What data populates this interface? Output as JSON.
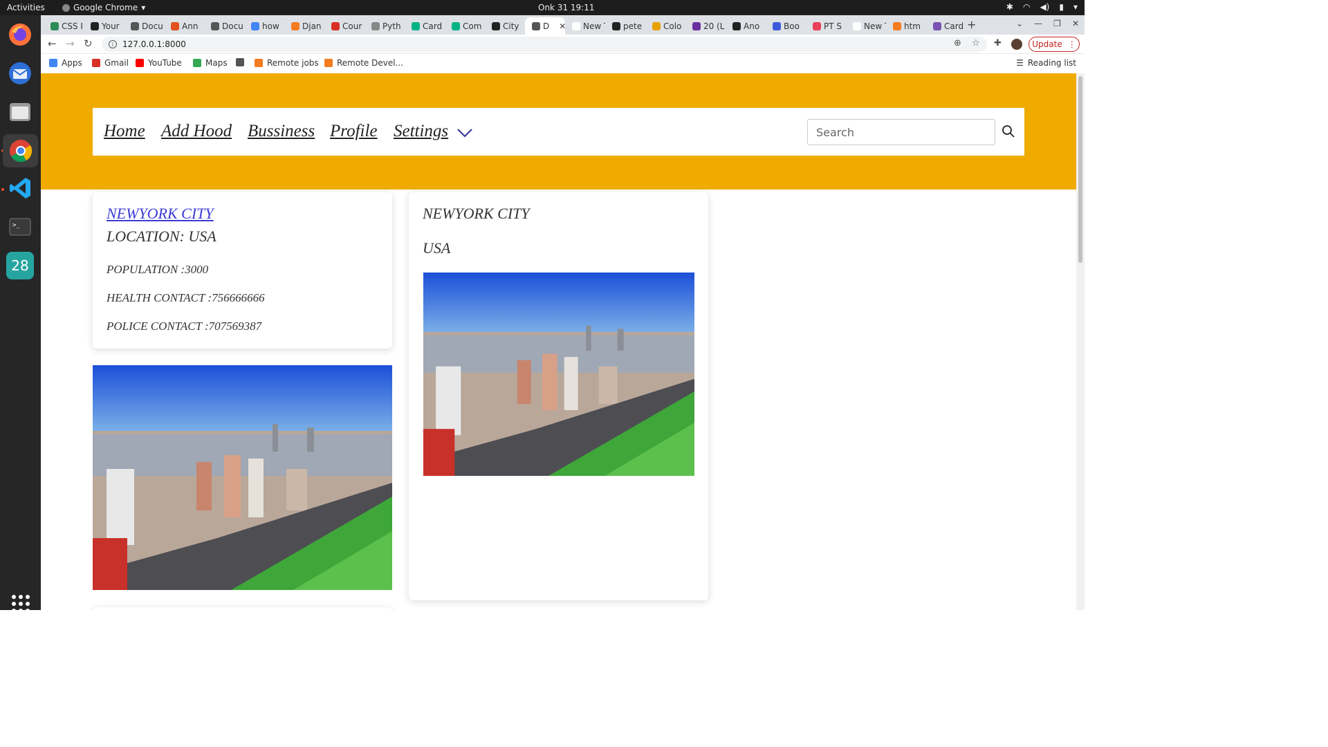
{
  "os": {
    "activities": "Activities",
    "app_name": "Google Chrome",
    "clock": "Onk 31  19:11",
    "calendar_day": "28"
  },
  "browser": {
    "tabs": [
      {
        "label": "CSS I",
        "color": "#2e8b57"
      },
      {
        "label": "Your",
        "color": "#222222"
      },
      {
        "label": "Docu",
        "color": "#555555"
      },
      {
        "label": "Ann",
        "color": "#e0521e"
      },
      {
        "label": "Docu",
        "color": "#555555"
      },
      {
        "label": "how",
        "color": "#4285f4"
      },
      {
        "label": "Djan",
        "color": "#f47b20"
      },
      {
        "label": "Cour",
        "color": "#d93025"
      },
      {
        "label": "Pyth",
        "color": "#888888"
      },
      {
        "label": "Card",
        "color": "#00b386"
      },
      {
        "label": "Com",
        "color": "#00b386"
      },
      {
        "label": "City",
        "color": "#222222"
      },
      {
        "label": "D",
        "color": "#555555",
        "active": true
      },
      {
        "label": "New Ta",
        "color": "#ffffff"
      },
      {
        "label": "pete",
        "color": "#222222"
      },
      {
        "label": "Colo",
        "color": "#e8a200"
      },
      {
        "label": "20 (L",
        "color": "#6b2fa0"
      },
      {
        "label": "Ano",
        "color": "#222222"
      },
      {
        "label": "Boo",
        "color": "#3b5bdb"
      },
      {
        "label": "PT S",
        "color": "#e94057"
      },
      {
        "label": "New Ta",
        "color": "#ffffff"
      },
      {
        "label": "htm",
        "color": "#f47b20"
      },
      {
        "label": "Card",
        "color": "#7952b3"
      }
    ],
    "url": "127.0.0.1:8000",
    "update_label": "Update",
    "bookmarks": [
      {
        "label": "Apps",
        "color": "#4285f4"
      },
      {
        "label": "Gmail",
        "color": "#d93025"
      },
      {
        "label": "YouTube",
        "color": "#ff0000"
      },
      {
        "label": "Maps",
        "color": "#34a853"
      },
      {
        "label": "",
        "color": "#555555"
      },
      {
        "label": "Remote jobs",
        "color": "#f47b20"
      },
      {
        "label": "Remote Devel...",
        "color": "#f47b20"
      }
    ],
    "reading_list": "Reading list"
  },
  "page": {
    "accent": "#f0ab00",
    "nav": [
      {
        "label": "Home"
      },
      {
        "label": "Add Hood"
      },
      {
        "label": "Bussiness"
      },
      {
        "label": "Profile"
      },
      {
        "label": "Settings"
      }
    ],
    "search_placeholder": "Search",
    "hood_card": {
      "city": "NEWYORK CITY",
      "location": "LOCATION: USA",
      "population": "POPULATION :3000",
      "health": "HEALTH CONTACT :756666666",
      "police": "POLICE CONTACT :707569387"
    },
    "detail_card": {
      "name": "NEWYORK CITY",
      "country": "USA"
    }
  }
}
